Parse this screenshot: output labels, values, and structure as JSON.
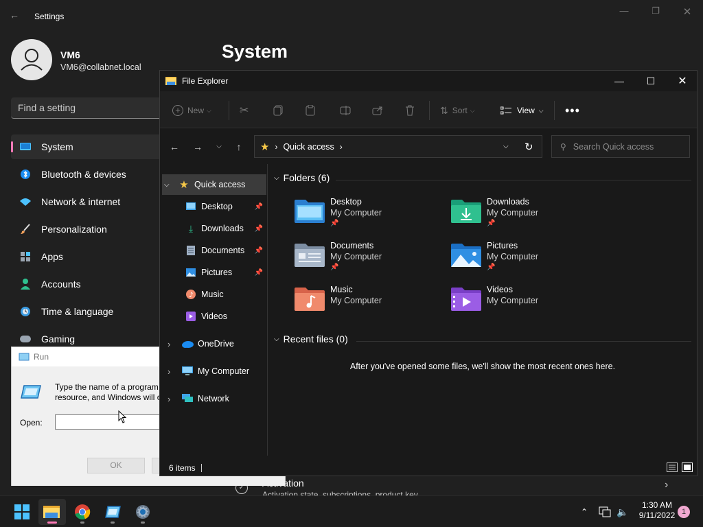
{
  "settings": {
    "title": "Settings",
    "user_name": "VM6",
    "user_email": "VM6@collabnet.local",
    "search_placeholder": "Find a setting",
    "page_title": "System",
    "nav": [
      {
        "label": "System",
        "icon": "monitor-icon"
      },
      {
        "label": "Bluetooth & devices",
        "icon": "bluetooth-icon"
      },
      {
        "label": "Network & internet",
        "icon": "wifi-icon"
      },
      {
        "label": "Personalization",
        "icon": "brush-icon"
      },
      {
        "label": "Apps",
        "icon": "apps-icon"
      },
      {
        "label": "Accounts",
        "icon": "person-icon"
      },
      {
        "label": "Time & language",
        "icon": "clock-globe-icon"
      },
      {
        "label": "Gaming",
        "icon": "gamepad-icon"
      }
    ],
    "activation": {
      "title": "Activation",
      "subtitle": "Activation state, subscriptions, product key"
    }
  },
  "run": {
    "title": "Run",
    "description": "Type the name of a program, folder, document, or Internet resource, and Windows will open it for you.",
    "open_label": "Open:",
    "open_value": "",
    "ok_label": "OK"
  },
  "explorer": {
    "title": "File Explorer",
    "toolbar": {
      "new": "New",
      "sort": "Sort",
      "view": "View"
    },
    "address": {
      "location": "Quick access"
    },
    "search_placeholder": "Search Quick access",
    "tree": {
      "quick_access": "Quick access",
      "pinned": [
        {
          "label": "Desktop",
          "pinned": true
        },
        {
          "label": "Downloads",
          "pinned": true
        },
        {
          "label": "Documents",
          "pinned": true
        },
        {
          "label": "Pictures",
          "pinned": true
        },
        {
          "label": "Music",
          "pinned": false
        },
        {
          "label": "Videos",
          "pinned": false
        }
      ],
      "onedrive": "OneDrive",
      "my_computer": "My Computer",
      "network": "Network"
    },
    "folders_header": "Folders (6)",
    "folders": [
      {
        "name": "Desktop",
        "location": "My Computer",
        "pinned": true
      },
      {
        "name": "Downloads",
        "location": "My Computer",
        "pinned": true
      },
      {
        "name": "Documents",
        "location": "My Computer",
        "pinned": true
      },
      {
        "name": "Pictures",
        "location": "My Computer",
        "pinned": true
      },
      {
        "name": "Music",
        "location": "My Computer",
        "pinned": false
      },
      {
        "name": "Videos",
        "location": "My Computer",
        "pinned": false
      }
    ],
    "recent_header": "Recent files (0)",
    "recent_empty": "After you've opened some files, we'll show the most recent ones here.",
    "status_items": "6 items"
  },
  "taskbar": {
    "time": "1:30 AM",
    "date": "9/11/2022",
    "notification_count": "1"
  }
}
